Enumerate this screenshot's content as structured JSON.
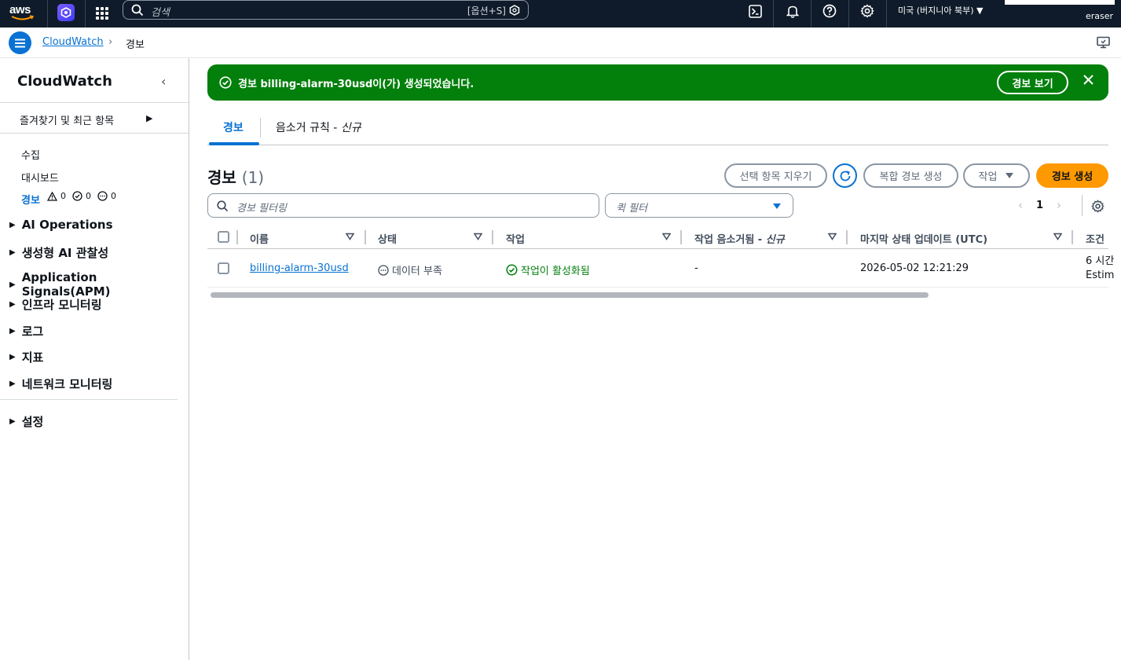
{
  "topbar": {
    "logo_text": "aws",
    "search_placeholder": "검색",
    "search_shortcut": "[옵션+S]",
    "region": "미국 (버지니아 북부) ▼",
    "account_name": "eraser"
  },
  "breadcrumb": {
    "service": "CloudWatch",
    "current": "경보"
  },
  "sidenav": {
    "title": "CloudWatch",
    "favorites": "즐겨찾기 및 최근 항목",
    "sub_items": [
      "수집",
      "대시보드",
      "경보"
    ],
    "alarm_counts": {
      "alarm": "0",
      "ok": "0",
      "insufficient": "0"
    },
    "groups": [
      "AI Operations",
      "생성형 AI 관찰성",
      "Application Signals(APM)",
      "인프라 모니터링",
      "로그",
      "지표",
      "네트워크 모니터링",
      "설정"
    ]
  },
  "flash": {
    "message": "경보 billing-alarm-30usd이(가) 생성되었습니다.",
    "action": "경보 보기"
  },
  "tabs": {
    "alarms": "경보",
    "mute_rules": "음소거 규칙 - ",
    "mute_rules_new": "신규"
  },
  "section": {
    "title": "경보",
    "count": "(1)"
  },
  "actions": {
    "clear_selection": "선택 항목 지우기",
    "create_composite": "복합 경보 생성",
    "actions": "작업",
    "create_alarm": "경보 생성"
  },
  "filters": {
    "search_placeholder": "경보 필터링",
    "quick_filter_placeholder": "퀵 필터"
  },
  "pager": {
    "page": "1"
  },
  "table": {
    "headers": {
      "name": "이름",
      "state": "상태",
      "actions": "작업",
      "action_muting": "작업 음소거됨 - ",
      "action_muting_new": "신규",
      "last_update": "마지막 상태 업데이트 (UTC)",
      "conditions": "조건"
    },
    "rows": [
      {
        "name": "billing-alarm-30usd",
        "state": "데이터 부족",
        "actions": "작업이 활성화됨",
        "muted": "-",
        "last_update": "2026-05-02 12:21:29",
        "conditions_line1": "6 시간",
        "conditions_line2": "Estim"
      }
    ]
  },
  "colors": {
    "topbar_bg": "#0f1b2a",
    "link_blue": "#0972d3",
    "success_green": "#037f0c",
    "primary_orange": "#ff9900"
  }
}
